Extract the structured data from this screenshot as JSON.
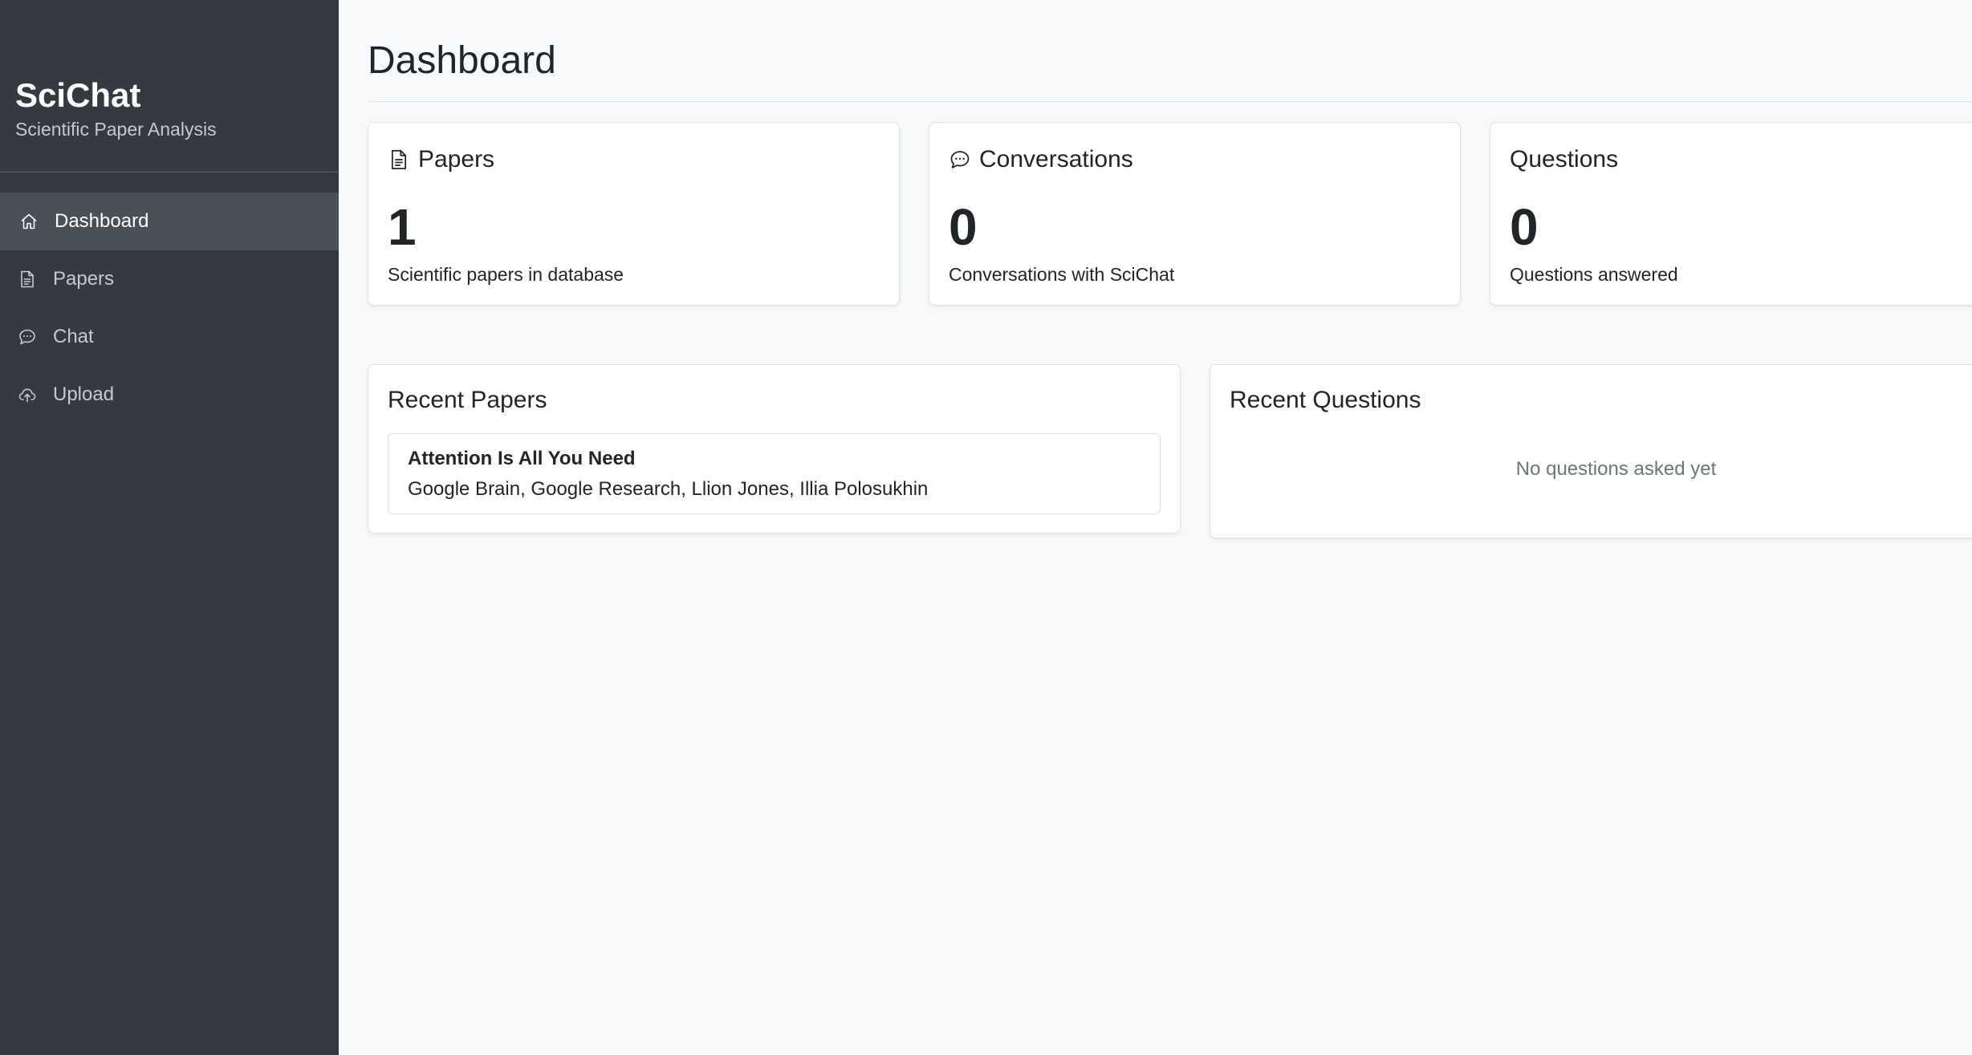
{
  "sidebar": {
    "brand_title": "SciChat",
    "brand_subtitle": "Scientific Paper Analysis",
    "items": [
      {
        "label": "Dashboard",
        "icon": "home-icon",
        "active": true
      },
      {
        "label": "Papers",
        "icon": "document-icon",
        "active": false
      },
      {
        "label": "Chat",
        "icon": "chat-icon",
        "active": false
      },
      {
        "label": "Upload",
        "icon": "cloud-upload-icon",
        "active": false
      }
    ]
  },
  "main": {
    "title": "Dashboard",
    "stats": [
      {
        "title": "Papers",
        "icon": "document-icon",
        "value": "1",
        "description": "Scientific papers in database"
      },
      {
        "title": "Conversations",
        "icon": "chat-icon",
        "value": "0",
        "description": "Conversations with SciChat"
      },
      {
        "title": "Questions",
        "icon": "",
        "value": "0",
        "description": "Questions answered"
      }
    ],
    "recent_papers": {
      "title": "Recent Papers",
      "items": [
        {
          "title": "Attention Is All You Need",
          "authors": "Google Brain, Google Research, Llion Jones, Illia Polosukhin"
        }
      ]
    },
    "recent_questions": {
      "title": "Recent Questions",
      "empty_text": "No questions asked yet"
    }
  },
  "colors": {
    "sidebar_bg": "#343a40",
    "sidebar_active_bg": "#495057",
    "page_bg": "#f8f9fa",
    "card_bg": "#ffffff",
    "muted_text": "#6c757d"
  }
}
